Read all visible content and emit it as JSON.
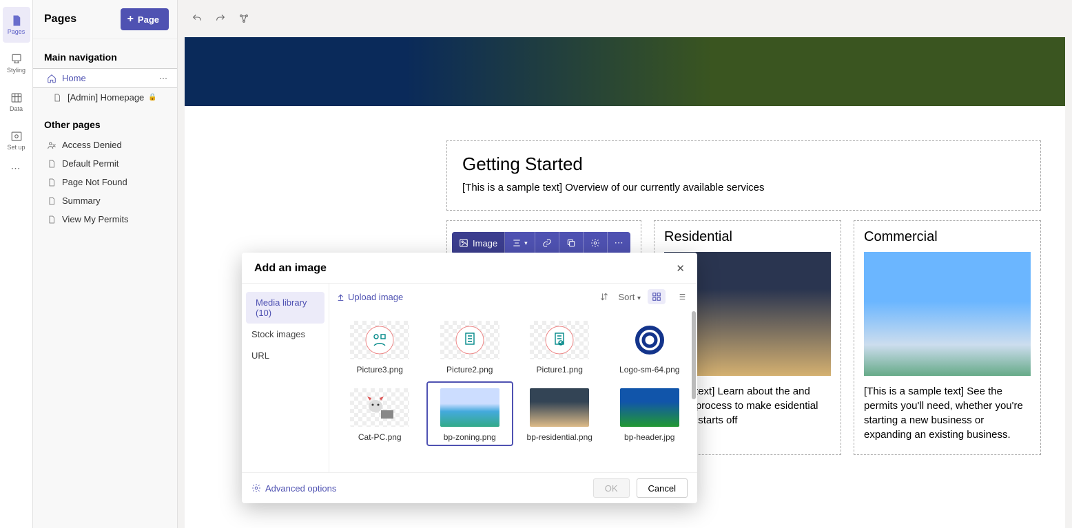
{
  "left_rail": {
    "items": [
      {
        "label": "Pages"
      },
      {
        "label": "Styling"
      },
      {
        "label": "Data"
      },
      {
        "label": "Set up"
      }
    ]
  },
  "side": {
    "title": "Pages",
    "new_btn": "Page",
    "sections": {
      "main_nav": "Main navigation",
      "other": "Other pages"
    },
    "main_items": [
      {
        "label": "Home"
      },
      {
        "label": "[Admin] Homepage"
      }
    ],
    "other_items": [
      {
        "label": "Access Denied"
      },
      {
        "label": "Default Permit"
      },
      {
        "label": "Page Not Found"
      },
      {
        "label": "Summary"
      },
      {
        "label": "View My Permits"
      }
    ]
  },
  "page": {
    "gs_title": "Getting Started",
    "gs_text": "[This is a sample text] Overview of our currently available services",
    "cards": [
      {
        "title": "Residential",
        "text": "ample text] Learn about the and permit process to make esidential project starts off"
      },
      {
        "title": "Commercial",
        "text": "[This is a sample text] See the permits you'll need, whether you're starting a new business or expanding an existing business."
      }
    ]
  },
  "context": {
    "label": "Image"
  },
  "dialog": {
    "title": "Add an image",
    "tabs": {
      "media": "Media library (10)",
      "stock": "Stock images",
      "url": "URL"
    },
    "upload": "Upload image",
    "sort": "Sort",
    "images": [
      {
        "name": "Picture3.png"
      },
      {
        "name": "Picture2.png"
      },
      {
        "name": "Picture1.png"
      },
      {
        "name": "Logo-sm-64.png"
      },
      {
        "name": "Cat-PC.png"
      },
      {
        "name": "bp-zoning.png"
      },
      {
        "name": "bp-residential.png"
      },
      {
        "name": "bp-header.jpg"
      }
    ],
    "advanced": "Advanced options",
    "ok": "OK",
    "cancel": "Cancel"
  }
}
